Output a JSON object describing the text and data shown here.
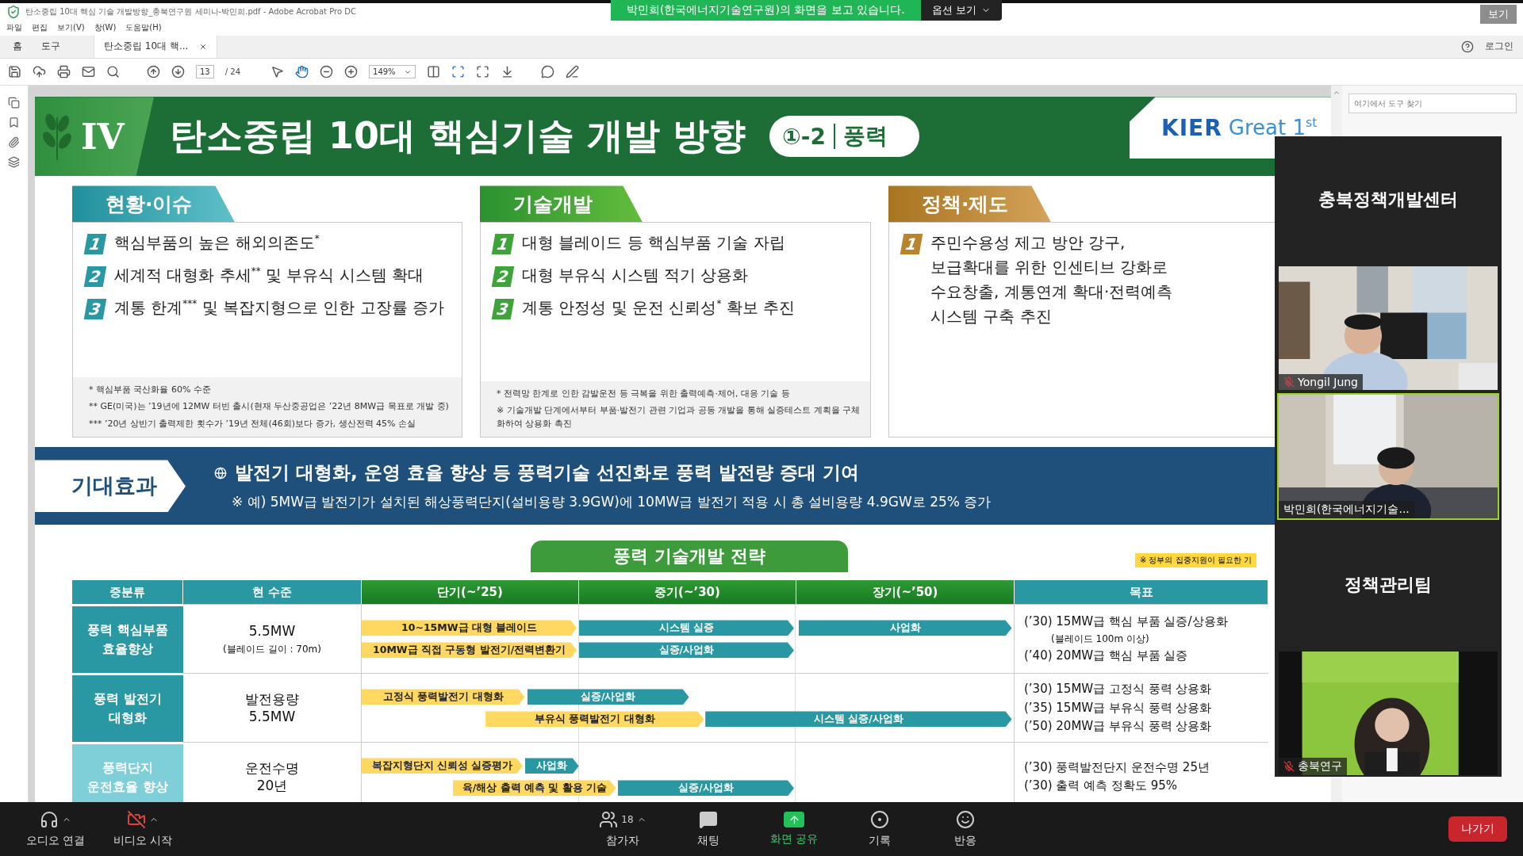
{
  "title_bar": {
    "title": "탄소중립 10대 핵심 기술 개발방향_충북연구원 세미나-박민희.pdf - Adobe Acrobat Pro DC",
    "view_button": "보기"
  },
  "share_banner": {
    "message": "박민희(한국에너지기술연구원)의 화면을 보고 있습니다.",
    "options": "옵션 보기"
  },
  "menu": [
    "파일",
    "편집",
    "보기(V)",
    "창(W)",
    "도움말(H)"
  ],
  "tabs": [
    {
      "label": "홈",
      "selected": false,
      "kind": "nav"
    },
    {
      "label": "도구",
      "selected": false,
      "kind": "nav"
    },
    {
      "label": "탄소중립 10대 핵...",
      "selected": true,
      "kind": "document"
    }
  ],
  "account": {
    "login": "로그인"
  },
  "toolbar": {
    "page": "13",
    "pages": "/ 24",
    "zoom": "149%"
  },
  "tools_pane": {
    "search_placeholder": "여기에서 도구 찾기"
  },
  "slide": {
    "chapter": "IV",
    "title": "탄소중립 10대 핵심기술 개발 방향",
    "badge_number": "①-2",
    "badge_label": "풍력",
    "logo": "KIER",
    "logo_tagline": "Great 1$^{st}$",
    "sections": [
      {
        "kind": "issue",
        "heading": "현황·이슈",
        "items": [
          {
            "number": "1",
            "text": "핵심부품의 높은 해외의존도$^{*}$"
          },
          {
            "number": "2",
            "text": "세계적 대형화 추세$^{**}$ 및 부유식 시스템 확대"
          },
          {
            "number": "3",
            "text": "계통 한계$^{***}$ 및 복잡지형으로 인한 고장률 증가"
          }
        ],
        "notes": [
          "* 핵심부품 국산화율 60% 수준",
          "** GE(미국)는 ’19년에 12MW 터빈 출시(현재 두산중공업은 ’22년 8MW급 목표로 개발 중)",
          "*** ’20년 상반기 출력제한 횟수가 ’19년 전체(46회)보다 증가, 생산전력 45% 손실"
        ]
      },
      {
        "kind": "tech",
        "heading": "기술개발",
        "items": [
          {
            "number": "1",
            "text": "대형 블레이드 등 핵심부품 기술 자립"
          },
          {
            "number": "2",
            "text": "대형 부유식 시스템 적기 상용화"
          },
          {
            "number": "3",
            "text": "계통 안정성 및 운전 신뢰성$^{*}$ 확보 추진"
          }
        ],
        "notes": [
          "* 전력망 한계로 인한 감발운전 등 극복을 위한 출력예측·제어, 대응 기술 등",
          "※ 기술개발 단계에서부터 부품·발전기 관련 기업과 공동 개발을 통해 실증테스트 계획을 구체화하여 상용화 촉진"
        ]
      },
      {
        "kind": "policy",
        "heading": "정책·제도",
        "items": [
          {
            "number": "1",
            "text": "주민수용성 제고 방안 강구, 보급확대를 위한 인센티브 강화로 수요창출, 계통연계 확대·전력예측 시스템 구축 추진"
          }
        ]
      }
    ],
    "effect": {
      "label": "기대효과",
      "headline": "발전기 대형화, 운영 효율 향상 등 풍력기술 선진화로 풍력 발전량 증대 기여",
      "detail": "※ 예) 5MW급 발전기가 설치된 해상풍력단지(설비용량 3.9GW)에 10MW급 발전기 적용 시 총 설비용량 4.9GW로 25% 증가"
    },
    "strategy": {
      "title": "풍력 기술개발 전략",
      "note": "※ 정부의 집중지원이 필요한 기",
      "columns": [
        "중분류",
        "현 수준",
        "단기(~’25)",
        "중기(~’30)",
        "장기(~’50)",
        "목표"
      ],
      "rows": [
        {
          "category": "풍력 핵심부품\n효율향상",
          "color": "#2a98a3",
          "current": "5.5MW",
          "current_note": "(블레이드 길이 : 70m)",
          "lanes": [
            [
              {
                "kind": "task",
                "label": "10~15MW급 대형 블레이드"
              },
              {
                "kind": "phase",
                "label": "시스템 실증"
              },
              {
                "kind": "phase",
                "label": "사업화"
              }
            ],
            [
              {
                "kind": "task",
                "label": "10MW급 직접 구동형 발전기/전력변환기"
              },
              {
                "kind": "phase",
                "label": "실증/사업화"
              }
            ]
          ],
          "goals": [
            {
              "kind": "goal",
              "text": "(’30) 15MW급 핵심 부품 실증/상용화"
            },
            {
              "kind": "note",
              "text": "(블레이드 100m 이상)"
            },
            {
              "kind": "goal",
              "text": "(’40) 20MW급 핵심 부품 실증"
            }
          ]
        },
        {
          "category": "풍력 발전기\n대형화",
          "color": "#2a98a3",
          "current": "발전용량\n5.5MW",
          "lanes": [
            [
              {
                "kind": "task",
                "label": "고정식 풍력발전기 대형화"
              },
              {
                "kind": "phase",
                "label": "실증/사업화"
              }
            ],
            [
              {
                "kind": "task",
                "label": "부유식 풍력발전기 대형화"
              },
              {
                "kind": "phase",
                "label": "시스템 실증/사업화"
              }
            ]
          ],
          "goals": [
            {
              "kind": "goal",
              "text": "(’30) 15MW급 고정식 풍력 상용화"
            },
            {
              "kind": "goal",
              "text": "(’35) 15MW급 부유식 풍력 상용화"
            },
            {
              "kind": "goal",
              "text": "(’50) 20MW급 부유식 풍력 상용화"
            }
          ]
        },
        {
          "category": "풍력단지\n운전효율 향상",
          "color": "#7fcfd8",
          "current": "운전수명\n20년",
          "lanes": [
            [
              {
                "kind": "task",
                "label": "복잡지형단지 신뢰성 실증평가"
              },
              {
                "kind": "phase",
                "label": "사업화"
              }
            ],
            [
              {
                "kind": "task",
                "label": "육/해상 출력 예측 및 활용 기술"
              },
              {
                "kind": "phase",
                "label": "실증/사업화"
              }
            ]
          ],
          "goals": [
            {
              "kind": "goal",
              "text": "(’30) 풍력발전단지 운전수명 25년"
            },
            {
              "kind": "goal",
              "text": "(’30) 출력 예측 정확도 95%"
            }
          ]
        }
      ]
    }
  },
  "video_panel": {
    "tiles": [
      {
        "kind": "name",
        "name": "충북정책개발센터"
      },
      {
        "kind": "video",
        "name": "Yongil Jung",
        "muted": true,
        "speaking": false
      },
      {
        "kind": "video",
        "name": "박민희(한국에너지기술...",
        "muted": false,
        "speaking": true
      },
      {
        "kind": "name",
        "name": "정책관리팀"
      },
      {
        "kind": "video",
        "name": "충북연구",
        "muted": true,
        "speaking": false
      }
    ]
  },
  "meeting_toolbar": {
    "left": [
      {
        "label": "오디오 연결"
      },
      {
        "label": "비디오 시작"
      }
    ],
    "center": [
      {
        "label": "참가자",
        "count": "18",
        "active": false
      },
      {
        "label": "채팅",
        "active": false
      },
      {
        "label": "화면 공유",
        "active": true
      },
      {
        "label": "기록",
        "active": false
      },
      {
        "label": "반응",
        "active": false
      }
    ],
    "leave": "나가기"
  }
}
